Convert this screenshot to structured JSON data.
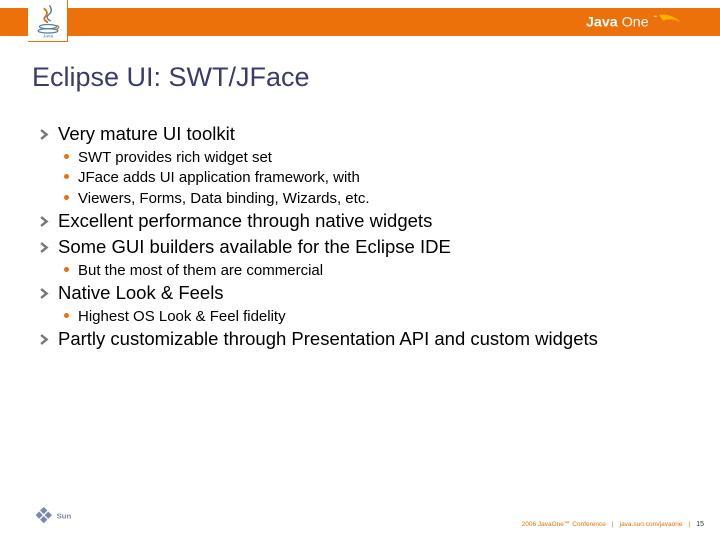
{
  "slide": {
    "title": "Eclipse UI: SWT/JFace",
    "brand_right": "JavaOne",
    "points": [
      {
        "text": "Very mature UI toolkit",
        "subs": [
          "SWT provides rich widget set",
          "JFace adds UI application framework, with",
          "Viewers, Forms, Data binding, Wizards, etc."
        ]
      },
      {
        "text": "Excellent performance through native widgets",
        "subs": []
      },
      {
        "text": "Some GUI builders available for the Eclipse IDE",
        "subs": [
          "But the most of them are commercial"
        ]
      },
      {
        "text": "Native Look & Feels",
        "subs": [
          "Highest OS Look & Feel fidelity"
        ]
      },
      {
        "text": "Partly customizable through Presentation API and custom widgets",
        "subs": []
      }
    ],
    "footer": {
      "conf": "2006 JavaOne℠ Conference",
      "url": "java.sun.com/javaone",
      "page": "15"
    }
  },
  "colors": {
    "accent": "#ec710a"
  }
}
